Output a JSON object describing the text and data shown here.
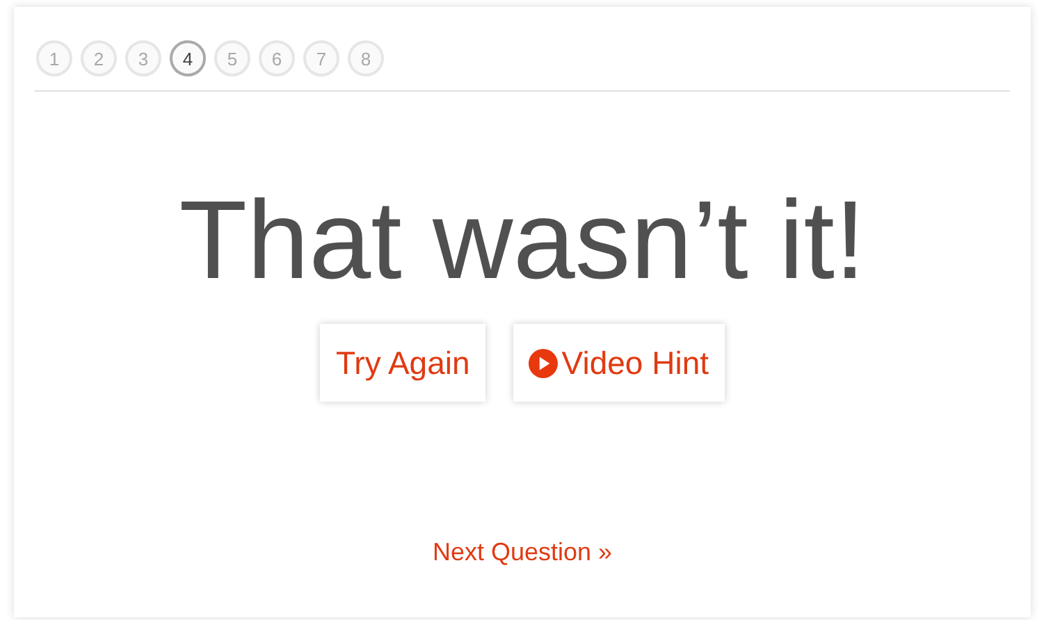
{
  "steps": [
    {
      "label": "1",
      "selected": false
    },
    {
      "label": "2",
      "selected": false
    },
    {
      "label": "3",
      "selected": false
    },
    {
      "label": "4",
      "selected": true
    },
    {
      "label": "5",
      "selected": false
    },
    {
      "label": "6",
      "selected": false
    },
    {
      "label": "7",
      "selected": false
    },
    {
      "label": "8",
      "selected": false
    }
  ],
  "heading": "That wasn’t it!",
  "buttons": [
    {
      "label": "Try Again",
      "kind": "plain"
    },
    {
      "label": "Video Hint",
      "kind": "video"
    }
  ],
  "next_link": "Next Question »"
}
